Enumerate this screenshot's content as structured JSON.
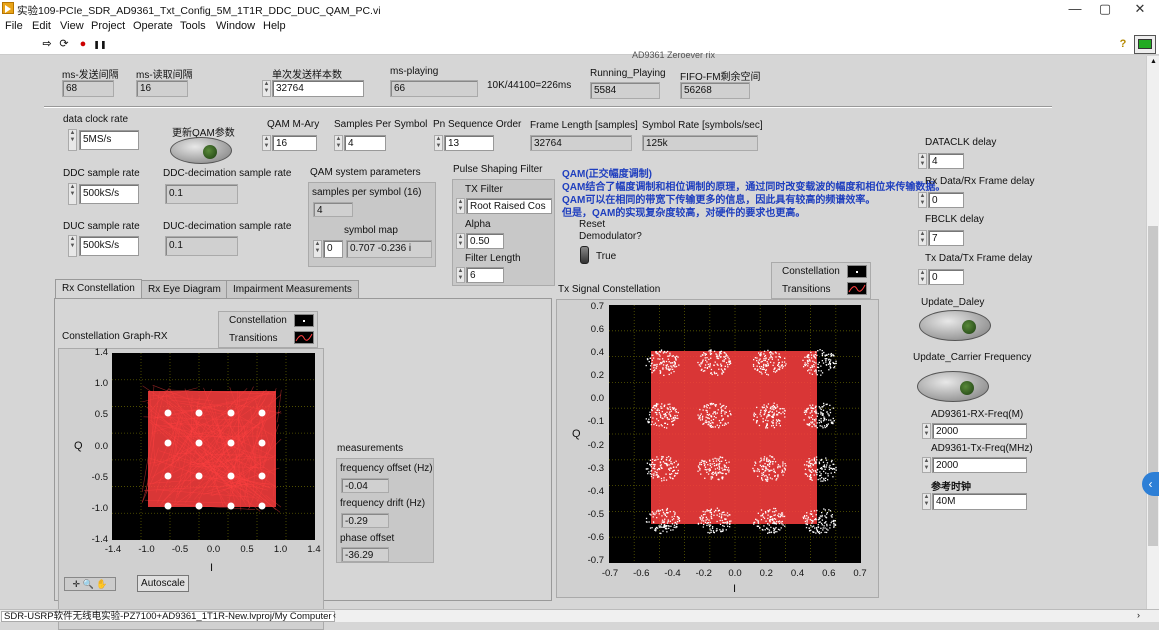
{
  "window": {
    "title": "实验109-PCIe_SDR_AD9361_Txt_Config_5M_1T1R_DDC_DUC_QAM_PC.vi",
    "min": "—",
    "max": "▢",
    "close": "✕"
  },
  "menu": [
    "File",
    "Edit",
    "View",
    "Project",
    "Operate",
    "Tools",
    "Window",
    "Help"
  ],
  "toolbar": {
    "run": "⇨",
    "run_cont": "⟳",
    "abort": "●",
    "pause": "❚❚",
    "help": "?"
  },
  "top_section_hint": "AD9361 Zeroever rix",
  "row1": {
    "send_interval": {
      "label": "ms-发送间隔",
      "value": "68"
    },
    "read_interval": {
      "label": "ms-读取间隔",
      "value": "16"
    },
    "samples_per_send": {
      "label": "单次发送样本数",
      "value": "32764"
    },
    "ms_playing": {
      "label": "ms-playing",
      "value": "66"
    },
    "ratio_note": "10K/44100=226ms",
    "running_playing": {
      "label": "Running_Playing",
      "value": "5584"
    },
    "fifo_free": {
      "label": "FIFO-FM剩余空间",
      "value": "56268"
    }
  },
  "data_clock": {
    "label": "data clock rate",
    "value": "5MS/s"
  },
  "update_qam": {
    "label": "更新QAM参数"
  },
  "ddc": {
    "label": "DDC sample rate",
    "value": "500kS/s",
    "dec_label": "DDC-decimation sample rate",
    "dec_value": "0.1"
  },
  "duc": {
    "label": "DUC sample rate",
    "value": "500kS/s",
    "dec_label": "DUC-decimation sample rate",
    "dec_value": "0.1"
  },
  "qam_mary": {
    "label": "QAM M-Ary",
    "value": "16"
  },
  "sps": {
    "label": "Samples Per Symbol",
    "value": "4"
  },
  "pn_order": {
    "label": "Pn Sequence Order",
    "value": "13"
  },
  "frame_len": {
    "label": "Frame Length [samples]",
    "value": "32764"
  },
  "symbol_rate": {
    "label": "Symbol Rate [symbols/sec]",
    "value": "125k"
  },
  "qam_sys": {
    "label": "QAM system parameters",
    "sps_label": "samples per symbol (16)",
    "sps_value": "4",
    "map_label": "symbol map",
    "map_index": "0",
    "map_value": "0.707 -0.236 i"
  },
  "psf": {
    "label": "Pulse Shaping Filter",
    "tx_filter_label": "TX Filter",
    "tx_filter_value": "Root Raised Cos",
    "alpha_label": "Alpha",
    "alpha_value": "0.50",
    "flen_label": "Filter Length",
    "flen_value": "6"
  },
  "qam_note": {
    "title": "QAM(正交幅度调制)",
    "line1": "QAM结合了幅度调制和相位调制的原理，通过同时改变载波的幅度和相位来传输数据。",
    "line2": "QAM可以在相同的带宽下传输更多的信息，因此具有较高的频谱效率。",
    "line3": "但是，QAM的实现复杂度较高，对硬件的要求也更高。"
  },
  "reset_demod": {
    "label1": "Reset",
    "label2": "Demodulator?",
    "value": "True"
  },
  "right": {
    "dataclk_delay": {
      "label": "DATACLK delay",
      "value": "4"
    },
    "rx_frame_delay": {
      "label": "Rx Data/Rx Frame delay",
      "value": "0"
    },
    "fbclk_delay": {
      "label": "FBCLK delay",
      "value": "7"
    },
    "tx_frame_delay": {
      "label": "Tx Data/Tx Frame delay",
      "value": "0"
    },
    "update_delay": {
      "label": "Update_Daley"
    },
    "update_carrier": {
      "label": "Update_Carrier Frequency"
    },
    "rx_freq": {
      "label": "AD9361-RX-Freq(M)",
      "value": "2000"
    },
    "tx_freq": {
      "label": "AD9361-Tx-Freq(MHz)",
      "value": "2000"
    },
    "ref_clk": {
      "label": "参考时钟",
      "value": "40M"
    }
  },
  "tabs": [
    "Rx Constellation",
    "Rx Eye Diagram",
    "Impairment Measurements"
  ],
  "rx_graph": {
    "title": "Constellation Graph-RX",
    "legend": [
      "Constellation",
      "Transitions"
    ],
    "ylabel": "Q",
    "xlabel": "I",
    "yticks": [
      "1.4",
      "1.0",
      "0.5",
      "0.0",
      "-0.5",
      "-1.0",
      "-1.4"
    ],
    "xticks": [
      "-1.4",
      "-1.0",
      "-0.5",
      "0.0",
      "0.5",
      "1.0",
      "1.4"
    ],
    "autoscale": "Autoscale"
  },
  "measurements": {
    "title": "measurements",
    "freq_offset_label": "frequency offset (Hz)",
    "freq_offset": "-0.04",
    "freq_drift_label": "frequency drift (Hz)",
    "freq_drift": "-0.29",
    "phase_offset_label": "phase offset",
    "phase_offset": "-36.29"
  },
  "tx_graph": {
    "title": "Tx Signal Constellation",
    "legend": [
      "Constellation",
      "Transitions"
    ],
    "ylabel": "Q",
    "xlabel": "I",
    "yticks": [
      "0.7",
      "0.6",
      "0.4",
      "0.2",
      "0.0",
      "-0.1",
      "-0.2",
      "-0.3",
      "-0.4",
      "-0.5",
      "-0.6",
      "-0.7"
    ],
    "xticks": [
      "-0.7",
      "-0.6",
      "-0.4",
      "-0.2",
      "0.0",
      "0.2",
      "0.4",
      "0.6",
      "0.7"
    ]
  },
  "status": {
    "path": "SDR-USRP软件无线电实验-PZ7100+AD9361_1T1R-New.lvproj/My Computer"
  },
  "colors": {
    "plot_bg": "#000000",
    "grid": "#5a5a00",
    "trace": "#ff4040",
    "symbol": "#ffffff",
    "note_text": "#1f3fbf"
  }
}
